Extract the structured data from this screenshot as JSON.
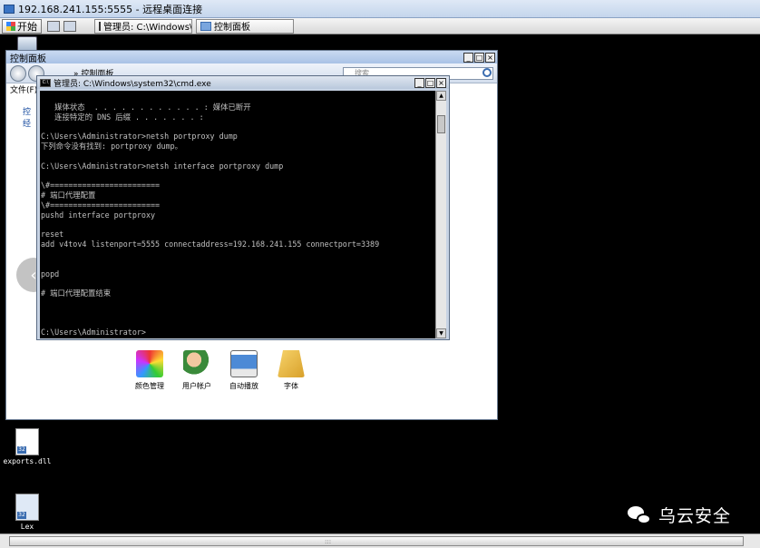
{
  "rdp": {
    "title": "192.168.241.155:5555 - 远程桌面连接"
  },
  "taskbar": {
    "start_label": "开始",
    "tasks": [
      "管理员: C:\\Windows\\...",
      "控制面板"
    ]
  },
  "desktop": {
    "icons": [
      {
        "label": "exports.dll"
      },
      {
        "label": "Lex"
      }
    ]
  },
  "control_panel": {
    "title": "控制面板",
    "address_text": "» 控制面板",
    "search_placeholder": "搜索",
    "menu_file": "文件(F)",
    "left_links": [
      "控",
      "经"
    ],
    "items": [
      {
        "label": "颜色管理",
        "icon": "color-management-icon"
      },
      {
        "label": "用户帐户",
        "icon": "user-accounts-icon"
      },
      {
        "label": "自动播放",
        "icon": "autoplay-icon"
      },
      {
        "label": "字体",
        "icon": "fonts-folder-icon"
      }
    ]
  },
  "cmd": {
    "title": "管理员: C:\\Windows\\system32\\cmd.exe",
    "lines": [
      "   媒体状态  . . . . . . . . . . . . : 媒体已断开",
      "   连接特定的 DNS 后缀 . . . . . . . :",
      "",
      "C:\\Users\\Administrator>netsh portproxy dump",
      "下列命令没有找到: portproxy dump。",
      "",
      "C:\\Users\\Administrator>netsh interface portproxy dump",
      "",
      "\\#========================",
      "# 端口代理配置",
      "\\#========================",
      "pushd interface portproxy",
      "",
      "reset",
      "add v4tov4 listenport=5555 connectaddress=192.168.241.155 connectport=3389",
      "",
      "",
      "popd",
      "",
      "# 端口代理配置结束",
      "",
      "",
      "",
      "C:\\Users\\Administrator>"
    ]
  },
  "watermark": {
    "text": "乌云安全"
  },
  "colors": {
    "console_bg": "#000000",
    "console_fg": "#c0c0c0",
    "desktop_bg": "#000000"
  }
}
